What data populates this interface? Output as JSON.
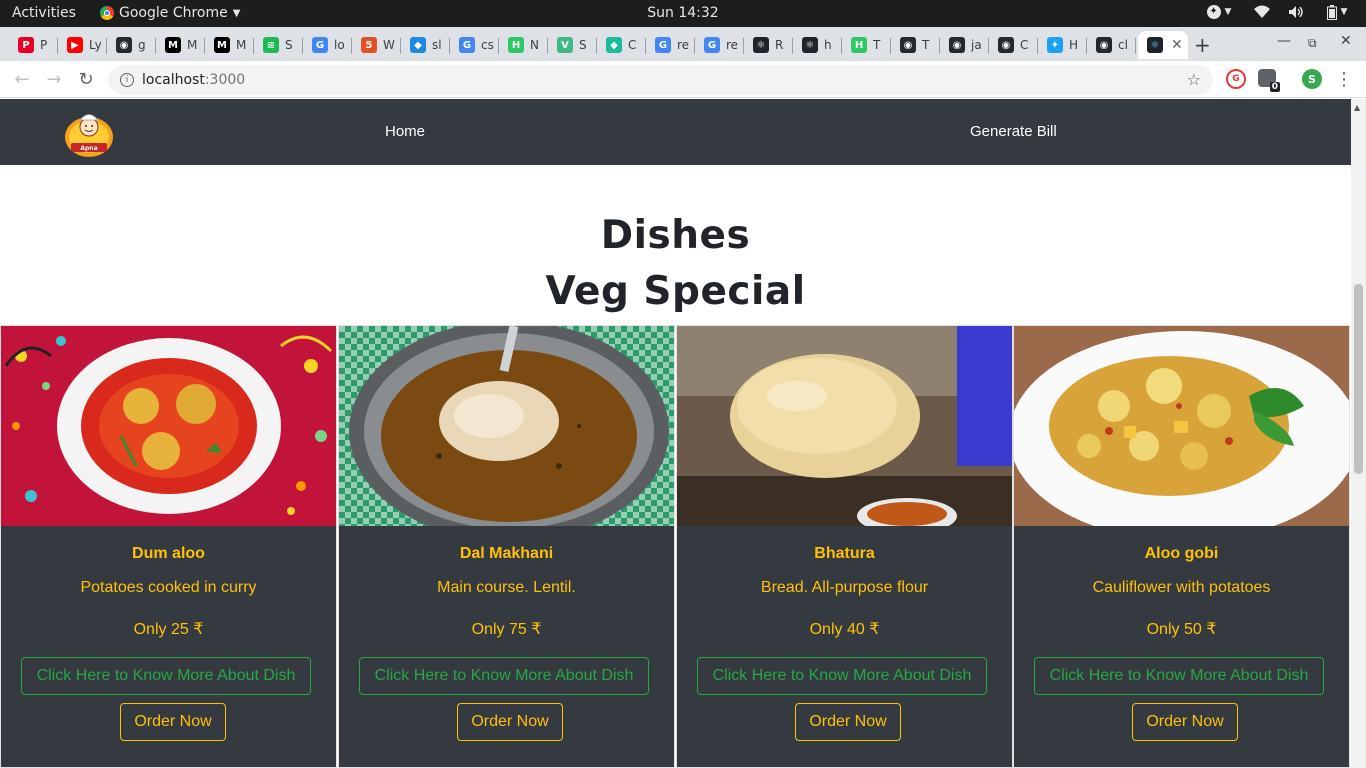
{
  "os": {
    "activities": "Activities",
    "app_name": "Google Chrome",
    "clock": "Sun 14:32"
  },
  "browser": {
    "tabs": [
      {
        "label": "P",
        "icon": "pinterest-icon",
        "color": "#e60023",
        "glyph": "P"
      },
      {
        "label": "Ly",
        "icon": "youtube-icon",
        "color": "#ff0000",
        "glyph": "▶"
      },
      {
        "label": "g",
        "icon": "github-icon",
        "color": "#24292e",
        "glyph": "◉"
      },
      {
        "label": "M",
        "icon": "medium-icon",
        "color": "#000000",
        "glyph": "M"
      },
      {
        "label": "M",
        "icon": "medium-icon",
        "color": "#000000",
        "glyph": "M"
      },
      {
        "label": "S",
        "icon": "spotify-icon",
        "color": "#1db954",
        "glyph": "≋"
      },
      {
        "label": "lo",
        "icon": "google-icon",
        "color": "#4285f4",
        "glyph": "G"
      },
      {
        "label": "W",
        "icon": "html5-icon",
        "color": "#e34f26",
        "glyph": "5"
      },
      {
        "label": "sl",
        "icon": "bird-icon",
        "color": "#1e88e5",
        "glyph": "◆"
      },
      {
        "label": "cs",
        "icon": "google-icon",
        "color": "#4285f4",
        "glyph": "G"
      },
      {
        "label": "N",
        "icon": "hackerrank-icon",
        "color": "#2ec866",
        "glyph": "H"
      },
      {
        "label": "S",
        "icon": "vue-icon",
        "color": "#41b883",
        "glyph": "V"
      },
      {
        "label": "C",
        "icon": "diamond-icon",
        "color": "#1abc9c",
        "glyph": "◆"
      },
      {
        "label": "re",
        "icon": "google-icon",
        "color": "#4285f4",
        "glyph": "G"
      },
      {
        "label": "re",
        "icon": "google-icon",
        "color": "#4285f4",
        "glyph": "G"
      },
      {
        "label": "R",
        "icon": "react-icon",
        "color": "#20232a",
        "glyph": "⚛"
      },
      {
        "label": "h",
        "icon": "react-icon",
        "color": "#20232a",
        "glyph": "⚛"
      },
      {
        "label": "T",
        "icon": "hackerrank-icon",
        "color": "#2ec866",
        "glyph": "H"
      },
      {
        "label": "T",
        "icon": "github-icon",
        "color": "#24292e",
        "glyph": "◉"
      },
      {
        "label": "ja",
        "icon": "github-icon",
        "color": "#24292e",
        "glyph": "◉"
      },
      {
        "label": "C",
        "icon": "github-icon",
        "color": "#24292e",
        "glyph": "◉"
      },
      {
        "label": "H",
        "icon": "twitter-icon",
        "color": "#1da1f2",
        "glyph": "✦"
      },
      {
        "label": "cl",
        "icon": "github-icon",
        "color": "#24292e",
        "glyph": "◉"
      }
    ],
    "active_tab_icon": "react-icon",
    "url_host": "localhost",
    "url_port": ":3000",
    "extension_badge": "0",
    "profile_initial": "S"
  },
  "navbar": {
    "logo_text": "Apna Khana Khazana",
    "links": [
      "Home",
      "Generate Bill"
    ]
  },
  "heading": {
    "title": "Dishes",
    "subtitle": "Veg Special"
  },
  "dishes": [
    {
      "name": "Dum aloo",
      "description": "Potatoes cooked in curry",
      "price": "Only 25 ₹",
      "more_label": "Click Here to Know More About Dish",
      "order_label": "Order Now"
    },
    {
      "name": "Dal Makhani",
      "description": "Main course. Lentil.",
      "price": "Only 75 ₹",
      "more_label": "Click Here to Know More About Dish",
      "order_label": "Order Now"
    },
    {
      "name": "Bhatura",
      "description": "Bread. All-purpose flour",
      "price": "Only 40 ₹",
      "more_label": "Click Here to Know More About Dish",
      "order_label": "Order Now"
    },
    {
      "name": "Aloo gobi",
      "description": "Cauliflower with potatoes",
      "price": "Only 50 ₹",
      "more_label": "Click Here to Know More About Dish",
      "order_label": "Order Now"
    }
  ],
  "colors": {
    "navbar_bg": "#343a40",
    "accent_yellow": "#ffc107",
    "accent_green": "#28a745"
  }
}
